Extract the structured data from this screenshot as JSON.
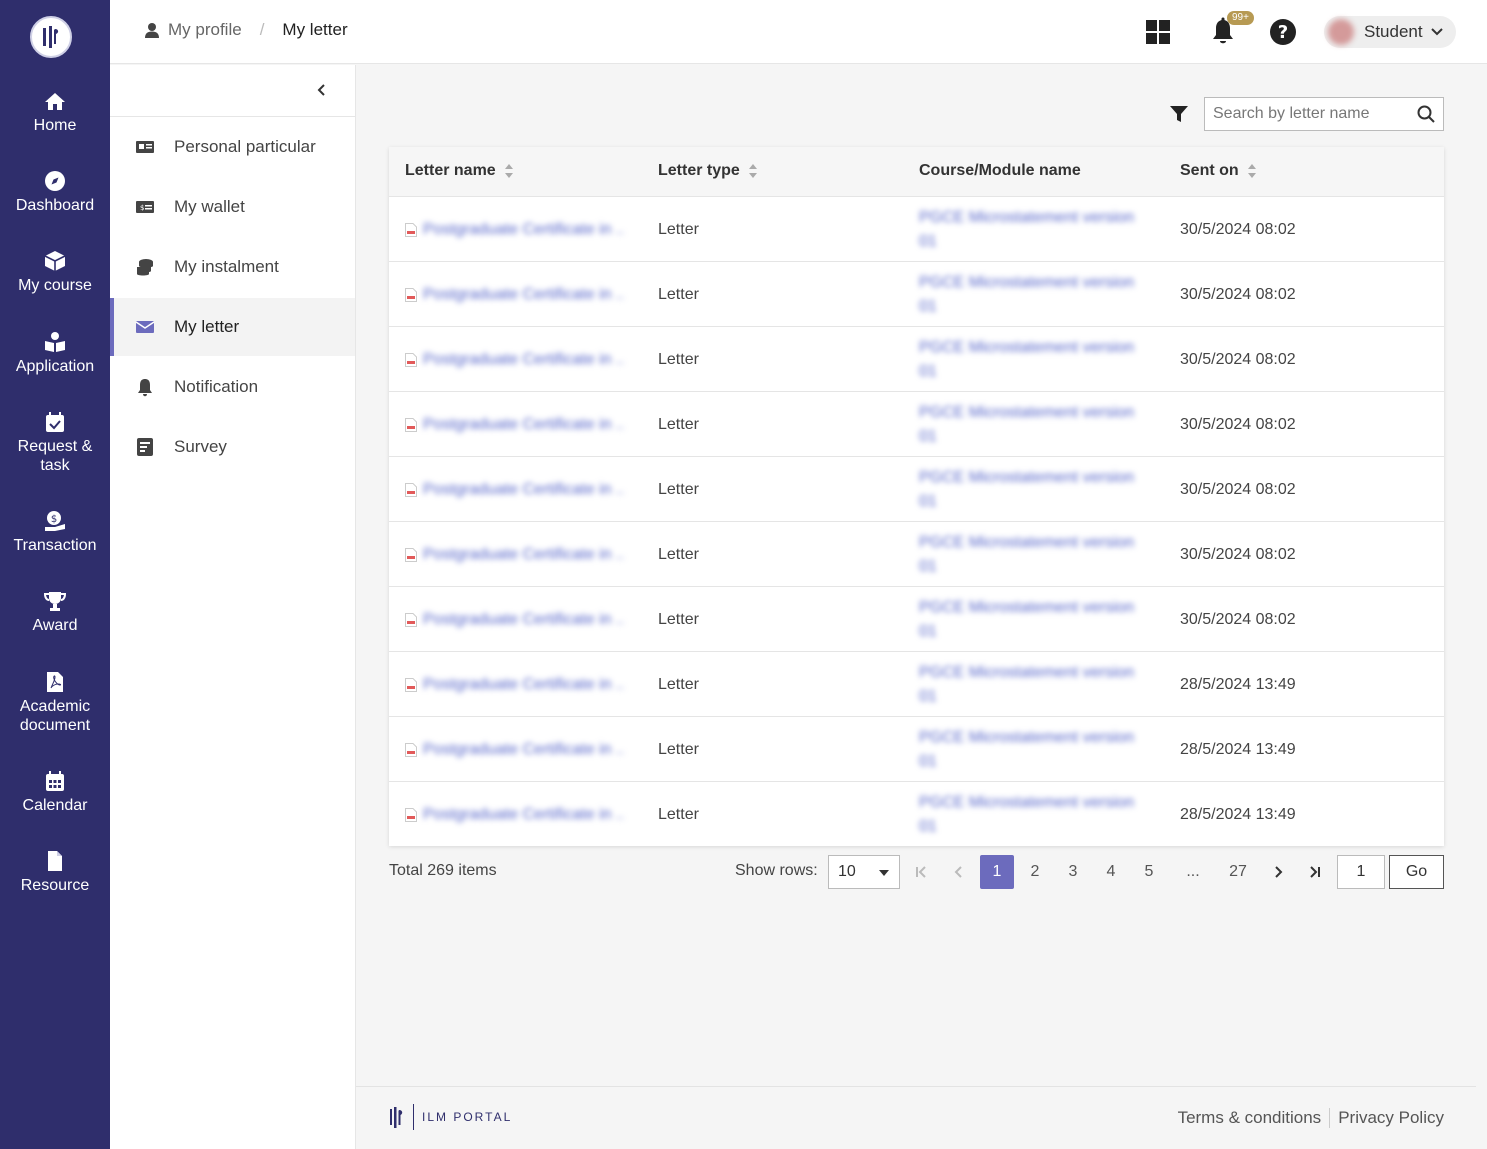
{
  "leftnav": {
    "items": [
      {
        "label": "Home",
        "icon": "home-icon"
      },
      {
        "label": "Dashboard",
        "icon": "compass-icon"
      },
      {
        "label": "My course",
        "icon": "box-icon"
      },
      {
        "label": "Application",
        "icon": "book-user-icon"
      },
      {
        "label": "Request & task",
        "icon": "calendar-check-icon"
      },
      {
        "label": "Transaction",
        "icon": "money-hand-icon"
      },
      {
        "label": "Award",
        "icon": "trophy-icon"
      },
      {
        "label": "Academic document",
        "icon": "pdf-file-icon"
      },
      {
        "label": "Calendar",
        "icon": "calendar-icon"
      },
      {
        "label": "Resource",
        "icon": "file-icon"
      }
    ]
  },
  "header": {
    "breadcrumb": {
      "parent": "My profile",
      "current": "My letter"
    },
    "notification_badge": "99+",
    "user_label": "Student"
  },
  "subnav": {
    "items": [
      {
        "label": "Personal particular",
        "icon": "id-card-icon"
      },
      {
        "label": "My wallet",
        "icon": "wallet-icon"
      },
      {
        "label": "My instalment",
        "icon": "coins-icon"
      },
      {
        "label": "My letter",
        "icon": "envelope-icon",
        "active": true
      },
      {
        "label": "Notification",
        "icon": "bell-icon"
      },
      {
        "label": "Survey",
        "icon": "survey-icon"
      }
    ]
  },
  "search": {
    "placeholder": "Search by letter name"
  },
  "table": {
    "headers": {
      "name": "Letter name",
      "type": "Letter type",
      "course": "Course/Module name",
      "sent": "Sent on"
    },
    "rows": [
      {
        "name": "Postgraduate Certificate in ...",
        "type": "Letter",
        "course": "PGCE Microstatement version 01",
        "sent": "30/5/2024 08:02"
      },
      {
        "name": "Postgraduate Certificate in ...",
        "type": "Letter",
        "course": "PGCE Microstatement version 01",
        "sent": "30/5/2024 08:02"
      },
      {
        "name": "Postgraduate Certificate in ...",
        "type": "Letter",
        "course": "PGCE Microstatement version 01",
        "sent": "30/5/2024 08:02"
      },
      {
        "name": "Postgraduate Certificate in ...",
        "type": "Letter",
        "course": "PGCE Microstatement version 01",
        "sent": "30/5/2024 08:02"
      },
      {
        "name": "Postgraduate Certificate in ...",
        "type": "Letter",
        "course": "PGCE Microstatement version 01",
        "sent": "30/5/2024 08:02"
      },
      {
        "name": "Postgraduate Certificate in ...",
        "type": "Letter",
        "course": "PGCE Microstatement version 01",
        "sent": "30/5/2024 08:02"
      },
      {
        "name": "Postgraduate Certificate in ...",
        "type": "Letter",
        "course": "PGCE Microstatement version 01",
        "sent": "30/5/2024 08:02"
      },
      {
        "name": "Postgraduate Certificate in ...",
        "type": "Letter",
        "course": "PGCE Microstatement version 01",
        "sent": "28/5/2024 13:49"
      },
      {
        "name": "Postgraduate Certificate in ...",
        "type": "Letter",
        "course": "PGCE Microstatement version 01",
        "sent": "28/5/2024 13:49"
      },
      {
        "name": "Postgraduate Certificate in ...",
        "type": "Letter",
        "course": "PGCE Microstatement version 01",
        "sent": "28/5/2024 13:49"
      }
    ]
  },
  "pagination": {
    "total": "Total 269 items",
    "show_rows_label": "Show rows:",
    "rows_value": "10",
    "pages": [
      "1",
      "2",
      "3",
      "4",
      "5",
      "...",
      "27"
    ],
    "goto_value": "1",
    "go_label": "Go"
  },
  "footer": {
    "brand": "ILM PORTAL",
    "terms": "Terms & conditions",
    "privacy": "Privacy Policy"
  },
  "colors": {
    "nav_bg": "#2f2e6c",
    "accent": "#6c6bbd",
    "badge": "#b79a53"
  }
}
